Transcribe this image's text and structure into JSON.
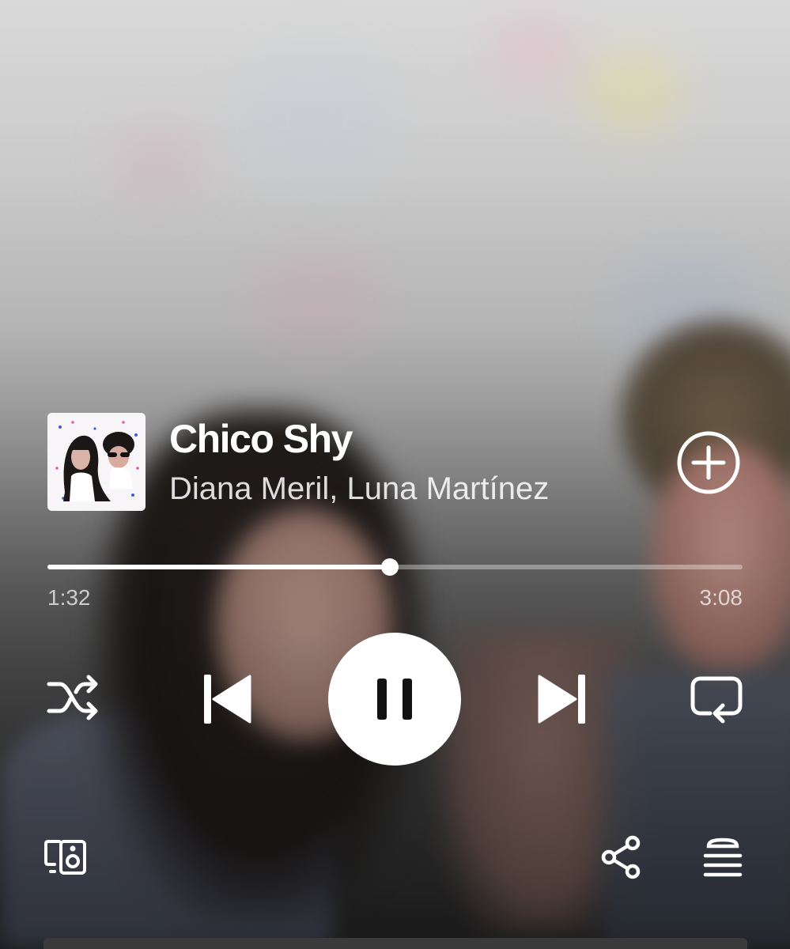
{
  "track": {
    "title": "Chico Shy",
    "artists": "Diana Meril, Luna Martínez",
    "album_art": "album-cover-two-women"
  },
  "playback": {
    "elapsed": "1:32",
    "duration": "3:08",
    "progress_fraction": 0.493,
    "state": "playing"
  },
  "controls": {
    "add": "plus-circle-icon",
    "shuffle": "shuffle-icon",
    "previous": "skip-previous-icon",
    "play_pause": "pause-icon",
    "next": "skip-next-icon",
    "repeat": "repeat-icon",
    "devices": "connect-devices-icon",
    "share": "share-icon",
    "queue": "queue-icon"
  },
  "colors": {
    "foreground": "#ffffff",
    "play_button": "#ffffff",
    "play_icon": "#111111"
  }
}
